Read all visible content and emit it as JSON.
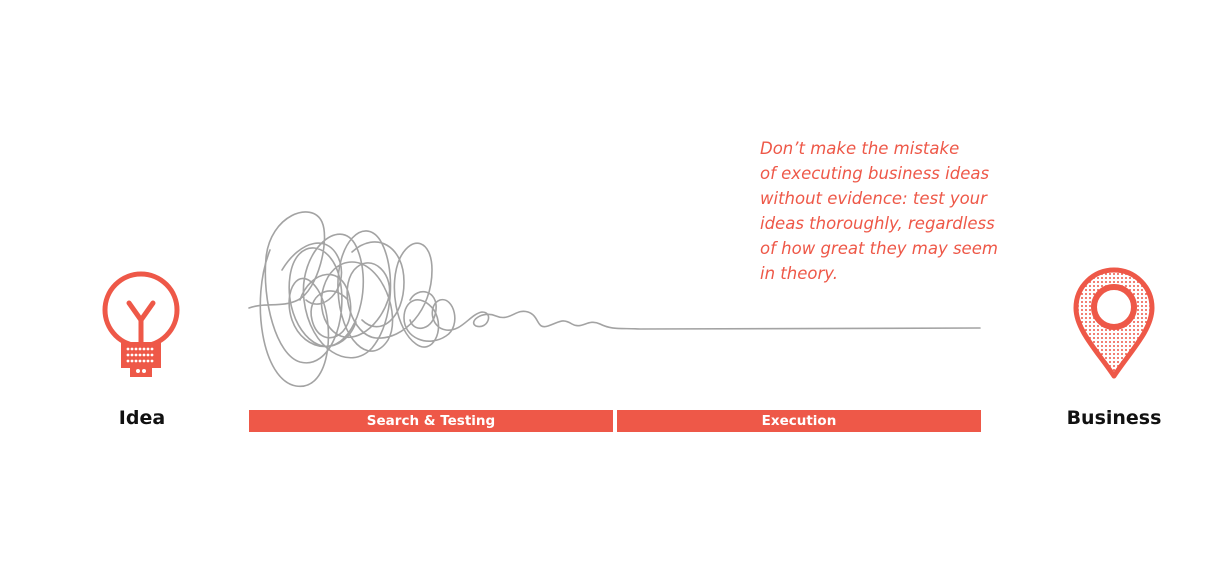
{
  "quote": {
    "lines": [
      "Don’t make the mistake",
      "of executing business ideas",
      "without evidence: test your",
      "ideas thoroughly, regardless",
      "of how great they may seem",
      "in theory."
    ]
  },
  "start": {
    "label": "Idea",
    "icon": "lightbulb-icon"
  },
  "end": {
    "label": "Business",
    "icon": "map-pin-icon"
  },
  "phases": [
    {
      "label": "Search & Testing"
    },
    {
      "label": "Execution"
    }
  ],
  "colors": {
    "accent": "#ee5848",
    "scribble": "#a3a3a3",
    "text": "#111111",
    "bar_text": "#ffffff"
  }
}
